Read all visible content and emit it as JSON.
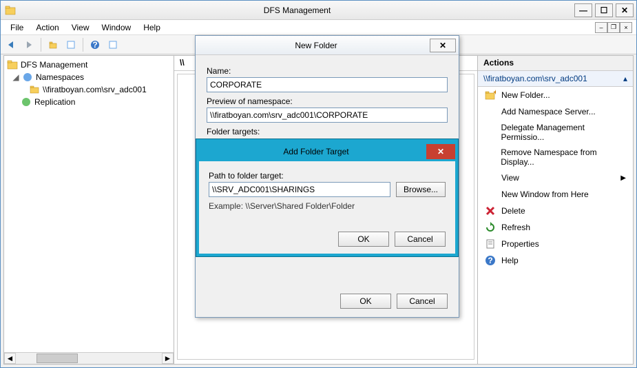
{
  "window": {
    "title": "DFS Management"
  },
  "menu": {
    "file": "File",
    "action": "Action",
    "view": "View",
    "window": "Window",
    "help": "Help"
  },
  "tree": {
    "root": "DFS Management",
    "namespaces": "Namespaces",
    "ns_item": "\\\\firatboyan.com\\srv_adc001",
    "replication": "Replication"
  },
  "center": {
    "header_prefix": "\\\\"
  },
  "actions": {
    "header": "Actions",
    "context": "\\\\firatboyan.com\\srv_adc001",
    "items": [
      "New Folder...",
      "Add Namespace Server...",
      "Delegate Management Permissio...",
      "Remove Namespace from Display...",
      "View",
      "New Window from Here",
      "Delete",
      "Refresh",
      "Properties",
      "Help"
    ]
  },
  "dlg_newfolder": {
    "title": "New Folder",
    "name_label": "Name:",
    "name_value": "CORPORATE",
    "preview_label": "Preview of namespace:",
    "preview_value": "\\\\firatboyan.com\\srv_adc001\\CORPORATE",
    "targets_label": "Folder targets:",
    "ok": "OK",
    "cancel": "Cancel"
  },
  "dlg_addtarget": {
    "title": "Add Folder Target",
    "path_label": "Path to folder target:",
    "path_value": "\\\\SRV_ADC001\\SHARINGS",
    "browse": "Browse...",
    "example": "Example: \\\\Server\\Shared Folder\\Folder",
    "ok": "OK",
    "cancel": "Cancel"
  }
}
